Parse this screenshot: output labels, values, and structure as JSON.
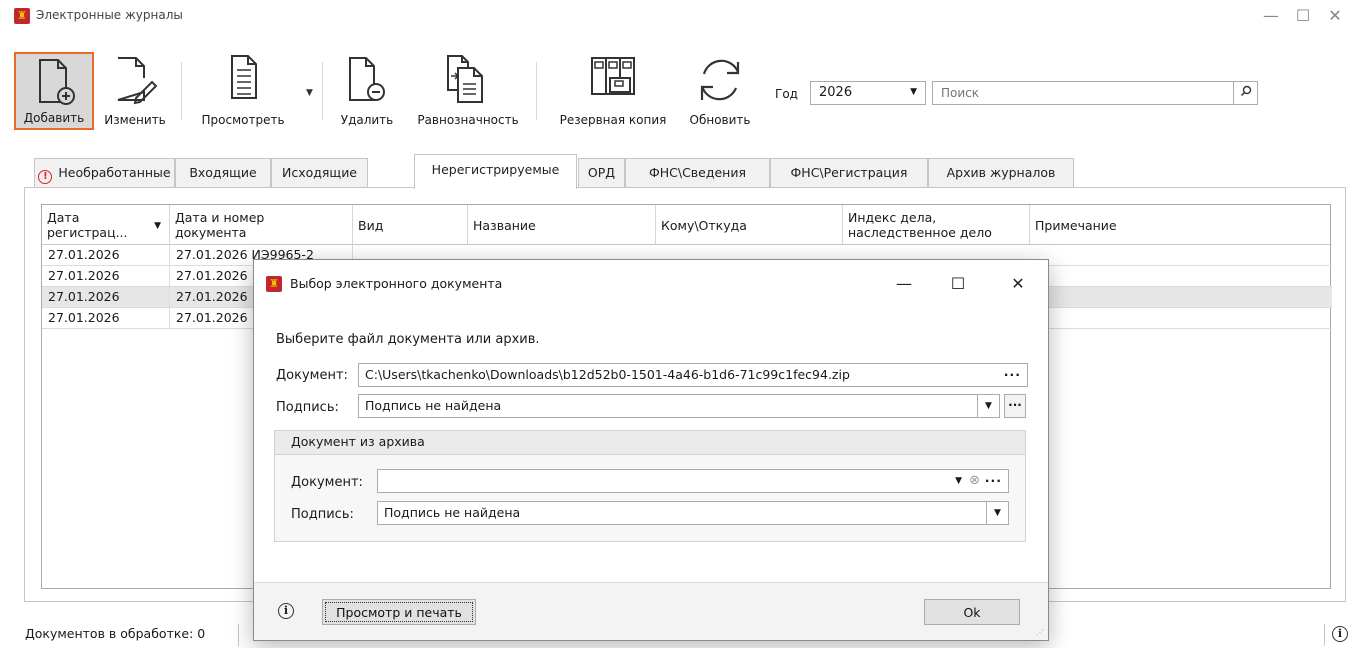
{
  "window": {
    "title": "Электронные журналы",
    "controls": {
      "minimize": "—",
      "maximize": "☐",
      "close": "✕"
    }
  },
  "toolbar": {
    "buttons": [
      {
        "label": "Добавить",
        "icon": "document-add-icon",
        "active": true
      },
      {
        "label": "Изменить",
        "icon": "document-edit-icon"
      },
      {
        "label": "Просмотреть",
        "icon": "document-view-icon",
        "has_dropdown": true
      },
      {
        "label": "Удалить",
        "icon": "document-remove-icon"
      },
      {
        "label": "Равнозначность",
        "icon": "documents-equivalence-icon"
      },
      {
        "label": "Резервная копия",
        "icon": "archive-backup-icon"
      },
      {
        "label": "Обновить",
        "icon": "refresh-icon"
      }
    ],
    "year_label": "Год",
    "year_value": "2026",
    "search_placeholder": "Поиск"
  },
  "tabs": [
    {
      "label": "Необработанные",
      "warning_icon": true
    },
    {
      "label": "Входящие"
    },
    {
      "label": "Исходящие"
    },
    {
      "label": "Нерегистрируемые",
      "active": true
    },
    {
      "label": "ОРД"
    },
    {
      "label": "ФНС\\Сведения"
    },
    {
      "label": "ФНС\\Регистрация"
    },
    {
      "label": "Архив журналов"
    }
  ],
  "table": {
    "columns": [
      {
        "label": "Дата регистрац...",
        "sorted": "desc"
      },
      {
        "label": "Дата и номер документа"
      },
      {
        "label": "Вид"
      },
      {
        "label": "Название"
      },
      {
        "label": "Кому\\Откуда"
      },
      {
        "label": "Индекс дела, наследственное дело"
      },
      {
        "label": "Примечание"
      }
    ],
    "rows": [
      {
        "date": "27.01.2026",
        "docnum": "27.01.2026 ИЭ9965-2"
      },
      {
        "date": "27.01.2026",
        "docnum": "27.01.2026"
      },
      {
        "date": "27.01.2026",
        "docnum": "27.01.2026",
        "selected": true
      },
      {
        "date": "27.01.2026",
        "docnum": "27.01.2026"
      }
    ]
  },
  "status": {
    "in_processing": "Документов в обработке: 0"
  },
  "dialog": {
    "title": "Выбор электронного документа",
    "prompt": "Выберите файл документа или архив.",
    "document_label": "Документ:",
    "document_value": "C:\\Users\\tkachenko\\Downloads\\b12d52b0-1501-4a46-b1d6-71c99c1fec94.zip",
    "signature_label": "Подпись:",
    "signature_value": "Подпись не найдена",
    "archive_group_title": "Документ из архива",
    "archive_document_label": "Документ:",
    "archive_document_value": "",
    "archive_signature_label": "Подпись:",
    "archive_signature_value": "Подпись не найдена",
    "preview_print_label": "Просмотр и печать",
    "ok_label": "Ok"
  }
}
